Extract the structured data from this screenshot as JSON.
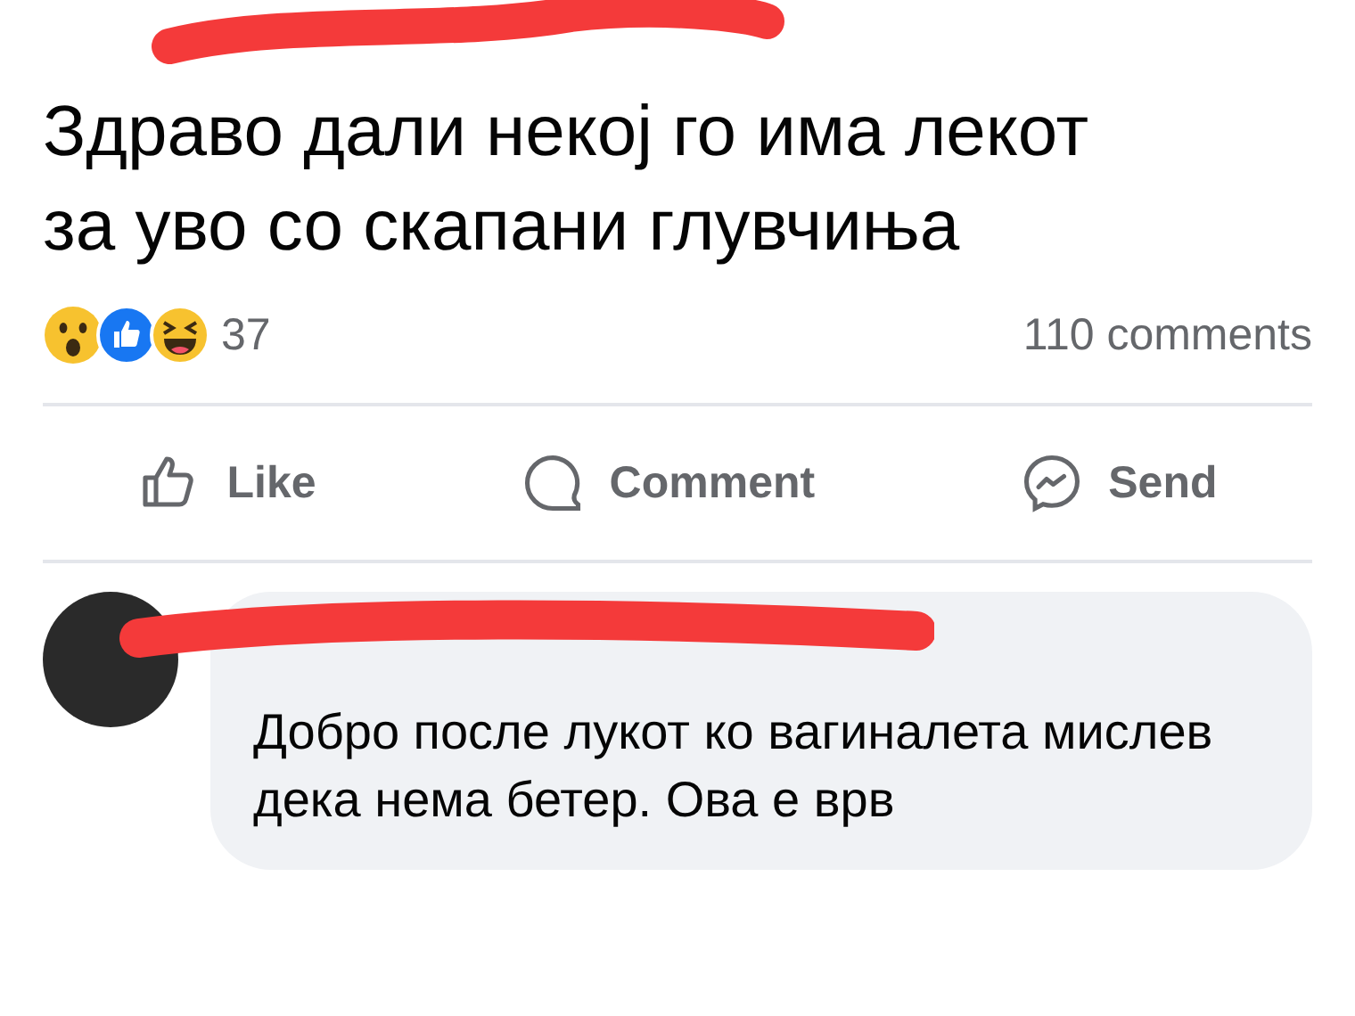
{
  "post": {
    "text": "Здраво дали некој го има лекот за уво со скапани глувчиња",
    "reaction_count": "37",
    "comment_count": "110 comments"
  },
  "actions": [
    {
      "kind": "like",
      "label": "Like"
    },
    {
      "kind": "comment",
      "label": "Comment"
    },
    {
      "kind": "send",
      "label": "Send"
    }
  ],
  "comment": {
    "text": "Добро после лукот ко вагиналета мислев дека нема бетер. Ова е врв"
  }
}
